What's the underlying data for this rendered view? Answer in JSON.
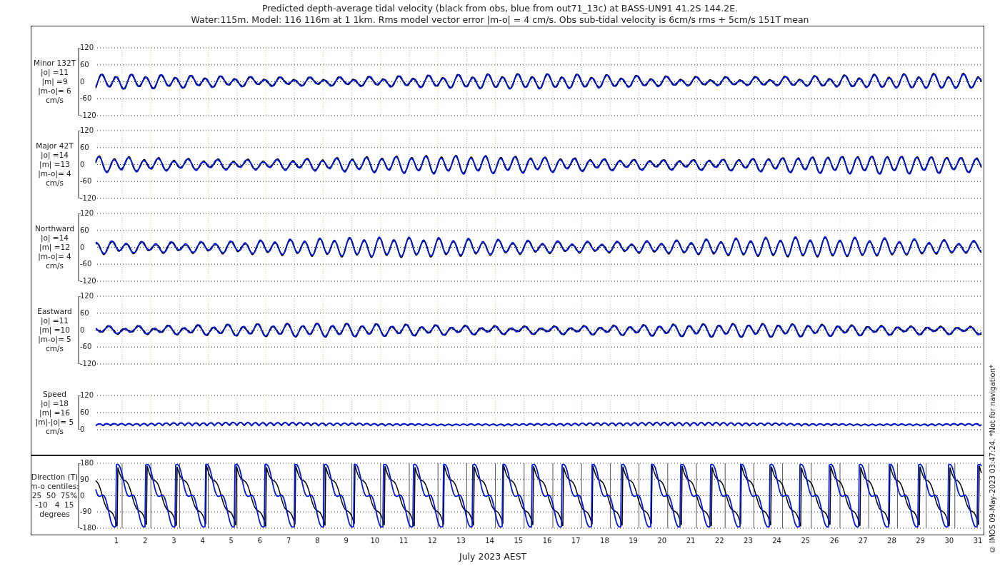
{
  "title": [
    "Predicted depth-average tidal velocity (black from obs, blue from out71_13c) at BASS-UN91 41.2S 144.2E.",
    "Water:115m. Model: 116 116m at 1 1km. Rms model vector error |m-o| = 4 cm/s. Obs sub-tidal velocity is 6cm/s rms + 5cm/s 151T mean"
  ],
  "panels": [
    {
      "kind": "velocity",
      "labels": [
        "Minor 132T",
        "|o| =11",
        "|m| =9",
        "|m-o|= 6",
        "cm/s"
      ],
      "yticks": [
        "120",
        "60",
        "0",
        "-60",
        "-120"
      ]
    },
    {
      "kind": "velocity",
      "labels": [
        "Major 42T",
        "|o| =14",
        "|m| =13",
        "|m-o|= 4",
        "cm/s"
      ],
      "yticks": [
        "120",
        "60",
        "0",
        "-60",
        "-120"
      ]
    },
    {
      "kind": "velocity",
      "labels": [
        "Northward",
        "|o| =14",
        "|m| =12",
        "|m-o|= 4",
        "cm/s"
      ],
      "yticks": [
        "120",
        "60",
        "0",
        "-60",
        "-120"
      ]
    },
    {
      "kind": "velocity",
      "labels": [
        "Eastward",
        "|o| =11",
        "|m| =10",
        "|m-o|= 5",
        "cm/s"
      ],
      "yticks": [
        "120",
        "60",
        "0",
        "-60",
        "-120"
      ]
    },
    {
      "kind": "speed",
      "labels": [
        "Speed",
        "|o| =18",
        "|m| =16",
        "|m|-|o|= 5",
        "cm/s"
      ],
      "yticks": [
        "120",
        "60",
        "0"
      ]
    },
    {
      "kind": "direction",
      "labels": [
        "Direction (T)",
        "m-o centiles:",
        "25  50  75%",
        "-10   4  15",
        "degrees"
      ],
      "yticks": [
        "180",
        "90",
        "0",
        "-90",
        "-180"
      ]
    }
  ],
  "xticks": [
    "1",
    "2",
    "3",
    "4",
    "5",
    "6",
    "7",
    "8",
    "9",
    "10",
    "11",
    "12",
    "13",
    "14",
    "15",
    "16",
    "17",
    "18",
    "19",
    "20",
    "21",
    "22",
    "23",
    "24",
    "25",
    "26",
    "27",
    "28",
    "29",
    "30",
    "31"
  ],
  "xlabel": "July 2023 AEST",
  "side_note": "© IMOS 09-May-2023 03:47:24. *Not for navigation*"
}
